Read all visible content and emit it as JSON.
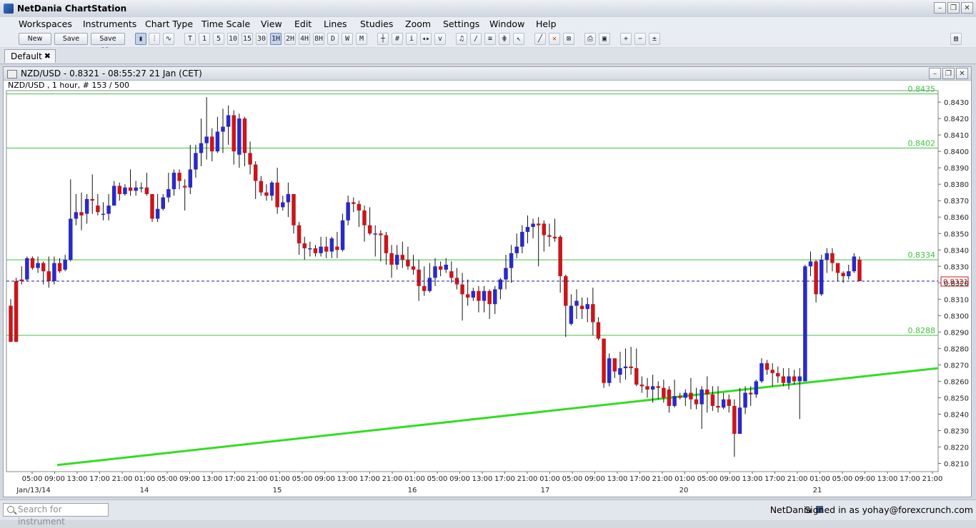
{
  "app": {
    "title": "NetDania ChartStation"
  },
  "window_controls": [
    "–",
    "❐",
    "✕"
  ],
  "menu": [
    "Workspaces",
    "Instruments",
    "Chart Type",
    "Time Scale",
    "View",
    "Edit",
    "Lines",
    "Studies",
    "Zoom",
    "Settings",
    "Window",
    "Help"
  ],
  "toolbar": {
    "new_label": "New",
    "save_label": "Save",
    "save_as_label": "Save as...",
    "timescales": [
      "T",
      "1",
      "5",
      "10",
      "15",
      "30",
      "1H",
      "2H",
      "4H",
      "8H",
      "D",
      "W",
      "M"
    ],
    "selected_timescale": "1H"
  },
  "tab": {
    "label": "Default",
    "close": "✖"
  },
  "chart_window": {
    "title": "NZD/USD - 0.8321 - 08:55:27  21 Jan (CET)",
    "subtitle": "NZD/USD , 1 hour, # 153 / 500"
  },
  "status": {
    "search_placeholder": "Search for instrument",
    "brand": "NetDania",
    "user": "Signed in as yohay@forexcrunch.com"
  },
  "colors": {
    "up": "#2a2ac6",
    "down": "#c8161b",
    "hline": "#3ec43e",
    "trendline": "#33dd22",
    "current": "#1a1aa0",
    "price_tag": "#d01818"
  },
  "chart_data": {
    "type": "candlestick",
    "instrument": "NZD/USD",
    "interval": "1 hour",
    "ylim": [
      0.8205,
      0.8437
    ],
    "y_ticks": [
      0.843,
      0.842,
      0.841,
      0.84,
      0.839,
      0.838,
      0.837,
      0.836,
      0.835,
      0.834,
      0.833,
      0.832,
      0.831,
      0.83,
      0.829,
      0.828,
      0.827,
      0.826,
      0.825,
      0.824,
      0.823,
      0.822,
      0.821
    ],
    "y_tick_labels": [
      "0.8430",
      "0.8420",
      "0.8410",
      "0.8400",
      "0.8390",
      "0.8380",
      "0.8370",
      "0.8360",
      "0.8350",
      "0.8340",
      "0.8330",
      "0.8320",
      "0.8310",
      "0.8300",
      "0.8290",
      "0.8280",
      "0.8270",
      "0.8260",
      "0.8250",
      "0.8240",
      "0.8230",
      "0.8220",
      "0.8210"
    ],
    "x_tick_labels": [
      "05:00",
      "09:00",
      "13:00",
      "17:00",
      "21:00",
      "01:00",
      "05:00",
      "09:00",
      "13:00",
      "17:00",
      "21:00",
      "01:00",
      "05:00",
      "09:00",
      "13:00",
      "17:00",
      "21:00",
      "01:00",
      "05:00",
      "09:00",
      "13:00",
      "17:00",
      "21:00",
      "01:00",
      "05:00",
      "09:00",
      "13:00",
      "17:00",
      "21:00",
      "01:00",
      "05:00",
      "09:00",
      "13:00",
      "17:00",
      "21:00",
      "01:00",
      "05:00",
      "09:00",
      "13:00",
      "17:00",
      "21:00"
    ],
    "date_labels": [
      "Jan/13/14",
      "14",
      "15",
      "16",
      "17",
      "20",
      "21"
    ],
    "horizontal_lines": [
      {
        "value": 0.8402,
        "label": "0.8402"
      },
      {
        "value": 0.8334,
        "label": "0.8334"
      },
      {
        "value": 0.8288,
        "label": "0.8288"
      },
      {
        "value": 0.8435,
        "label": "0.8435"
      }
    ],
    "current_price": 0.8321,
    "current_price_label": "0.8321",
    "trendline": {
      "from": 0.8209,
      "to": 0.8268
    },
    "candles": [
      [
        0.8306,
        0.8284,
        0.831,
        0.8284
      ],
      [
        0.8321,
        0.8284,
        0.8323,
        0.8284
      ],
      [
        0.8322,
        0.8321,
        0.833,
        0.8319
      ],
      [
        0.8322,
        0.8335,
        0.8336,
        0.8321
      ],
      [
        0.8335,
        0.8329,
        0.8336,
        0.8328
      ],
      [
        0.8329,
        0.8332,
        0.8336,
        0.8326
      ],
      [
        0.8332,
        0.8327,
        0.8333,
        0.8319
      ],
      [
        0.8327,
        0.8321,
        0.8336,
        0.8317
      ],
      [
        0.8321,
        0.8332,
        0.8336,
        0.8319
      ],
      [
        0.8332,
        0.8327,
        0.8335,
        0.8326
      ],
      [
        0.8328,
        0.8334,
        0.8337,
        0.8327
      ],
      [
        0.8334,
        0.8359,
        0.8383,
        0.8333
      ],
      [
        0.8359,
        0.8363,
        0.8374,
        0.8355
      ],
      [
        0.8363,
        0.8361,
        0.8375,
        0.8352
      ],
      [
        0.8362,
        0.8371,
        0.8374,
        0.8356
      ],
      [
        0.8371,
        0.837,
        0.8386,
        0.8362
      ],
      [
        0.8367,
        0.8363,
        0.8374,
        0.8361
      ],
      [
        0.8362,
        0.8362,
        0.8369,
        0.8358
      ],
      [
        0.8362,
        0.8367,
        0.8374,
        0.8358
      ],
      [
        0.8367,
        0.8379,
        0.8382,
        0.8367
      ],
      [
        0.8379,
        0.8374,
        0.8381,
        0.837
      ],
      [
        0.8374,
        0.8378,
        0.838,
        0.8373
      ],
      [
        0.8378,
        0.8376,
        0.8389,
        0.8373
      ],
      [
        0.8376,
        0.8378,
        0.8382,
        0.8373
      ],
      [
        0.8378,
        0.8378,
        0.8381,
        0.8375
      ],
      [
        0.8378,
        0.8374,
        0.8387,
        0.8373
      ],
      [
        0.8374,
        0.8359,
        0.8374,
        0.8357
      ],
      [
        0.8359,
        0.8365,
        0.8374,
        0.8357
      ],
      [
        0.8365,
        0.8372,
        0.8374,
        0.8364
      ],
      [
        0.8372,
        0.8377,
        0.8387,
        0.8369
      ],
      [
        0.8377,
        0.8387,
        0.8389,
        0.8373
      ],
      [
        0.8387,
        0.8382,
        0.8389,
        0.8377
      ],
      [
        0.8379,
        0.8378,
        0.8383,
        0.8364
      ],
      [
        0.8378,
        0.8389,
        0.8404,
        0.8374
      ],
      [
        0.8389,
        0.8399,
        0.8404,
        0.8384
      ],
      [
        0.8399,
        0.8405,
        0.842,
        0.8391
      ],
      [
        0.8405,
        0.8409,
        0.8433,
        0.8395
      ],
      [
        0.8409,
        0.84,
        0.8414,
        0.8394
      ],
      [
        0.84,
        0.8412,
        0.8421,
        0.8399
      ],
      [
        0.8412,
        0.8415,
        0.8426,
        0.8399
      ],
      [
        0.8415,
        0.8422,
        0.8428,
        0.8404
      ],
      [
        0.8422,
        0.84,
        0.8425,
        0.8392
      ],
      [
        0.8398,
        0.842,
        0.8423,
        0.839
      ],
      [
        0.842,
        0.8399,
        0.8421,
        0.8391
      ],
      [
        0.8399,
        0.8392,
        0.8406,
        0.8386
      ],
      [
        0.8392,
        0.8382,
        0.8394,
        0.8371
      ],
      [
        0.8382,
        0.8375,
        0.8385,
        0.8373
      ],
      [
        0.8375,
        0.8373,
        0.838,
        0.837
      ],
      [
        0.8373,
        0.8381,
        0.8382,
        0.837
      ],
      [
        0.8381,
        0.8366,
        0.839,
        0.8362
      ],
      [
        0.8366,
        0.8369,
        0.8373,
        0.8364
      ],
      [
        0.8369,
        0.8374,
        0.8381,
        0.836
      ],
      [
        0.8374,
        0.8355,
        0.8374,
        0.835
      ],
      [
        0.8355,
        0.8344,
        0.8357,
        0.8337
      ],
      [
        0.8344,
        0.8341,
        0.8348,
        0.8334
      ],
      [
        0.8341,
        0.8341,
        0.8345,
        0.8336
      ],
      [
        0.8341,
        0.8338,
        0.8343,
        0.8336
      ],
      [
        0.8338,
        0.8342,
        0.8348,
        0.8336
      ],
      [
        0.8342,
        0.8339,
        0.8348,
        0.8335
      ],
      [
        0.8339,
        0.8347,
        0.8348,
        0.8335
      ],
      [
        0.8342,
        0.834,
        0.8351,
        0.8335
      ],
      [
        0.834,
        0.8358,
        0.8362,
        0.8339
      ],
      [
        0.8358,
        0.8369,
        0.8373,
        0.8355
      ],
      [
        0.8369,
        0.8368,
        0.8372,
        0.8363
      ],
      [
        0.8368,
        0.8364,
        0.837,
        0.8354
      ],
      [
        0.8364,
        0.8355,
        0.8367,
        0.8345
      ],
      [
        0.8355,
        0.835,
        0.8366,
        0.8349
      ],
      [
        0.835,
        0.835,
        0.8355,
        0.8336
      ],
      [
        0.835,
        0.8349,
        0.8352,
        0.8333
      ],
      [
        0.8349,
        0.8338,
        0.8351,
        0.8331
      ],
      [
        0.8338,
        0.8331,
        0.8343,
        0.8323
      ],
      [
        0.8331,
        0.8337,
        0.8343,
        0.8328
      ],
      [
        0.8337,
        0.8334,
        0.8345,
        0.8329
      ],
      [
        0.8334,
        0.833,
        0.8342,
        0.8328
      ],
      [
        0.833,
        0.8328,
        0.8337,
        0.8325
      ],
      [
        0.8328,
        0.8318,
        0.8334,
        0.8309
      ],
      [
        0.8318,
        0.8315,
        0.833,
        0.8312
      ],
      [
        0.8315,
        0.8323,
        0.8332,
        0.8314
      ],
      [
        0.8323,
        0.833,
        0.8335,
        0.8318
      ],
      [
        0.833,
        0.8328,
        0.8333,
        0.8324
      ],
      [
        0.8328,
        0.8331,
        0.8335,
        0.8326
      ],
      [
        0.8327,
        0.8323,
        0.8333,
        0.832
      ],
      [
        0.8323,
        0.8319,
        0.8329,
        0.8316
      ],
      [
        0.8319,
        0.8313,
        0.8326,
        0.8297
      ],
      [
        0.8313,
        0.8311,
        0.8322,
        0.8306
      ],
      [
        0.8311,
        0.8315,
        0.8317,
        0.8309
      ],
      [
        0.8315,
        0.8309,
        0.8318,
        0.8302
      ],
      [
        0.8309,
        0.8315,
        0.8318,
        0.8302
      ],
      [
        0.8315,
        0.8307,
        0.8316,
        0.8298
      ],
      [
        0.8307,
        0.8316,
        0.8318,
        0.8301
      ],
      [
        0.8316,
        0.8322,
        0.8323,
        0.831
      ],
      [
        0.8322,
        0.8329,
        0.8337,
        0.8316
      ],
      [
        0.8329,
        0.8338,
        0.8343,
        0.832
      ],
      [
        0.8338,
        0.8342,
        0.835,
        0.8335
      ],
      [
        0.8342,
        0.8351,
        0.8355,
        0.8338
      ],
      [
        0.8351,
        0.8354,
        0.8361,
        0.8344
      ],
      [
        0.8354,
        0.8356,
        0.8359,
        0.8347
      ],
      [
        0.8356,
        0.8355,
        0.836,
        0.833
      ],
      [
        0.8356,
        0.8349,
        0.8358,
        0.8339
      ],
      [
        0.8349,
        0.8348,
        0.8356,
        0.8342
      ],
      [
        0.8348,
        0.8347,
        0.8359,
        0.8345
      ],
      [
        0.8348,
        0.8324,
        0.8349,
        0.8314
      ],
      [
        0.8324,
        0.8306,
        0.8325,
        0.8287
      ],
      [
        0.8295,
        0.8306,
        0.8313,
        0.8294
      ],
      [
        0.8306,
        0.8309,
        0.8316,
        0.8298
      ],
      [
        0.8306,
        0.8304,
        0.8311,
        0.8298
      ],
      [
        0.8304,
        0.8307,
        0.8311,
        0.8296
      ],
      [
        0.8307,
        0.8296,
        0.8317,
        0.8288
      ],
      [
        0.8296,
        0.8286,
        0.8299,
        0.8285
      ],
      [
        0.8286,
        0.8259,
        0.8286,
        0.8256
      ],
      [
        0.8259,
        0.8274,
        0.8277,
        0.8257
      ],
      [
        0.8274,
        0.8266,
        0.8274,
        0.8262
      ],
      [
        0.8264,
        0.8268,
        0.8278,
        0.8259
      ],
      [
        0.8268,
        0.8269,
        0.828,
        0.8261
      ],
      [
        0.8269,
        0.8268,
        0.8281,
        0.8264
      ],
      [
        0.8268,
        0.8258,
        0.828,
        0.8257
      ],
      [
        0.8258,
        0.8257,
        0.8263,
        0.8253
      ],
      [
        0.8257,
        0.8255,
        0.8262,
        0.825
      ],
      [
        0.8255,
        0.8257,
        0.8264,
        0.8247
      ],
      [
        0.8257,
        0.8256,
        0.826,
        0.8249
      ],
      [
        0.8256,
        0.825,
        0.8261,
        0.8247
      ],
      [
        0.8255,
        0.8245,
        0.8257,
        0.8241
      ],
      [
        0.8245,
        0.8251,
        0.8261,
        0.8244
      ],
      [
        0.8251,
        0.825,
        0.8253,
        0.8249
      ],
      [
        0.825,
        0.8253,
        0.8255,
        0.8245
      ],
      [
        0.8253,
        0.8249,
        0.8262,
        0.8243
      ],
      [
        0.8249,
        0.8246,
        0.8256,
        0.8243
      ],
      [
        0.8246,
        0.8255,
        0.8257,
        0.8231
      ],
      [
        0.8255,
        0.8252,
        0.8263,
        0.8241
      ],
      [
        0.8252,
        0.8245,
        0.8257,
        0.8242
      ],
      [
        0.8245,
        0.8244,
        0.8257,
        0.8241
      ],
      [
        0.8244,
        0.8249,
        0.8253,
        0.8243
      ],
      [
        0.8249,
        0.8245,
        0.8252,
        0.8241
      ],
      [
        0.8245,
        0.8228,
        0.8249,
        0.8214
      ],
      [
        0.8228,
        0.8244,
        0.8256,
        0.8228
      ],
      [
        0.8244,
        0.8253,
        0.8257,
        0.824
      ],
      [
        0.8253,
        0.8252,
        0.8257,
        0.8245
      ],
      [
        0.8252,
        0.826,
        0.8261,
        0.825
      ],
      [
        0.826,
        0.8271,
        0.8274,
        0.8259
      ],
      [
        0.8271,
        0.8267,
        0.8273,
        0.8264
      ],
      [
        0.8267,
        0.8265,
        0.8271,
        0.8257
      ],
      [
        0.8265,
        0.8263,
        0.8269,
        0.8259
      ],
      [
        0.8263,
        0.8259,
        0.8268,
        0.8257
      ],
      [
        0.8259,
        0.8263,
        0.8268,
        0.8255
      ],
      [
        0.8263,
        0.826,
        0.8267,
        0.8258
      ],
      [
        0.826,
        0.8263,
        0.8268,
        0.8237
      ],
      [
        0.826,
        0.833,
        0.8331,
        0.826
      ],
      [
        0.833,
        0.8333,
        0.8339,
        0.8324
      ],
      [
        0.8333,
        0.8313,
        0.8334,
        0.8308
      ],
      [
        0.8313,
        0.8334,
        0.8337,
        0.8312
      ],
      [
        0.8334,
        0.8338,
        0.8341,
        0.8326
      ],
      [
        0.8338,
        0.8332,
        0.8341,
        0.8327
      ],
      [
        0.8332,
        0.8326,
        0.8331,
        0.8321
      ],
      [
        0.8326,
        0.8324,
        0.8327,
        0.832
      ],
      [
        0.8324,
        0.8327,
        0.8331,
        0.8322
      ],
      [
        0.8327,
        0.8336,
        0.8338,
        0.8326
      ],
      [
        0.8334,
        0.8321,
        0.8336,
        0.8321
      ]
    ]
  }
}
